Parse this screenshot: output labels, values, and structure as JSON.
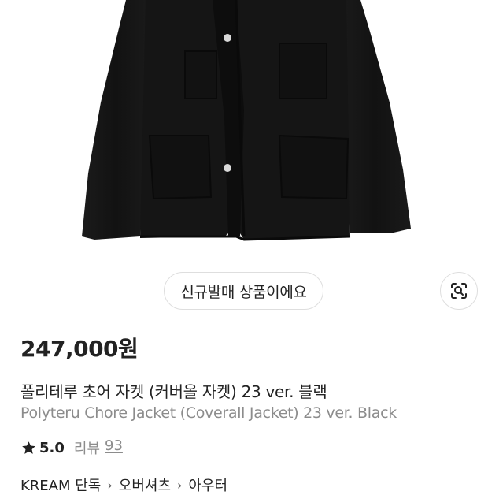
{
  "product": {
    "badge": "신규발매 상품이에요",
    "price": "247,000원",
    "title_ko": "폴리테루 초어 자켓 (커버올 자켓) 23 ver. 블랙",
    "title_en": "Polyteru Chore Jacket (Coverall Jacket) 23 ver. Black",
    "rating": "5.0",
    "review_label": "리뷰",
    "review_count": "93"
  },
  "breadcrumb": {
    "items": [
      "KREAM 단독",
      "오버셔츠",
      "아우터"
    ],
    "separator": "›"
  },
  "icons": {
    "lens": "image-search-icon",
    "star": "star-icon"
  },
  "colors": {
    "text": "#222222",
    "muted": "#8c8c8c",
    "border": "#dedede",
    "jacket": "#141414"
  }
}
